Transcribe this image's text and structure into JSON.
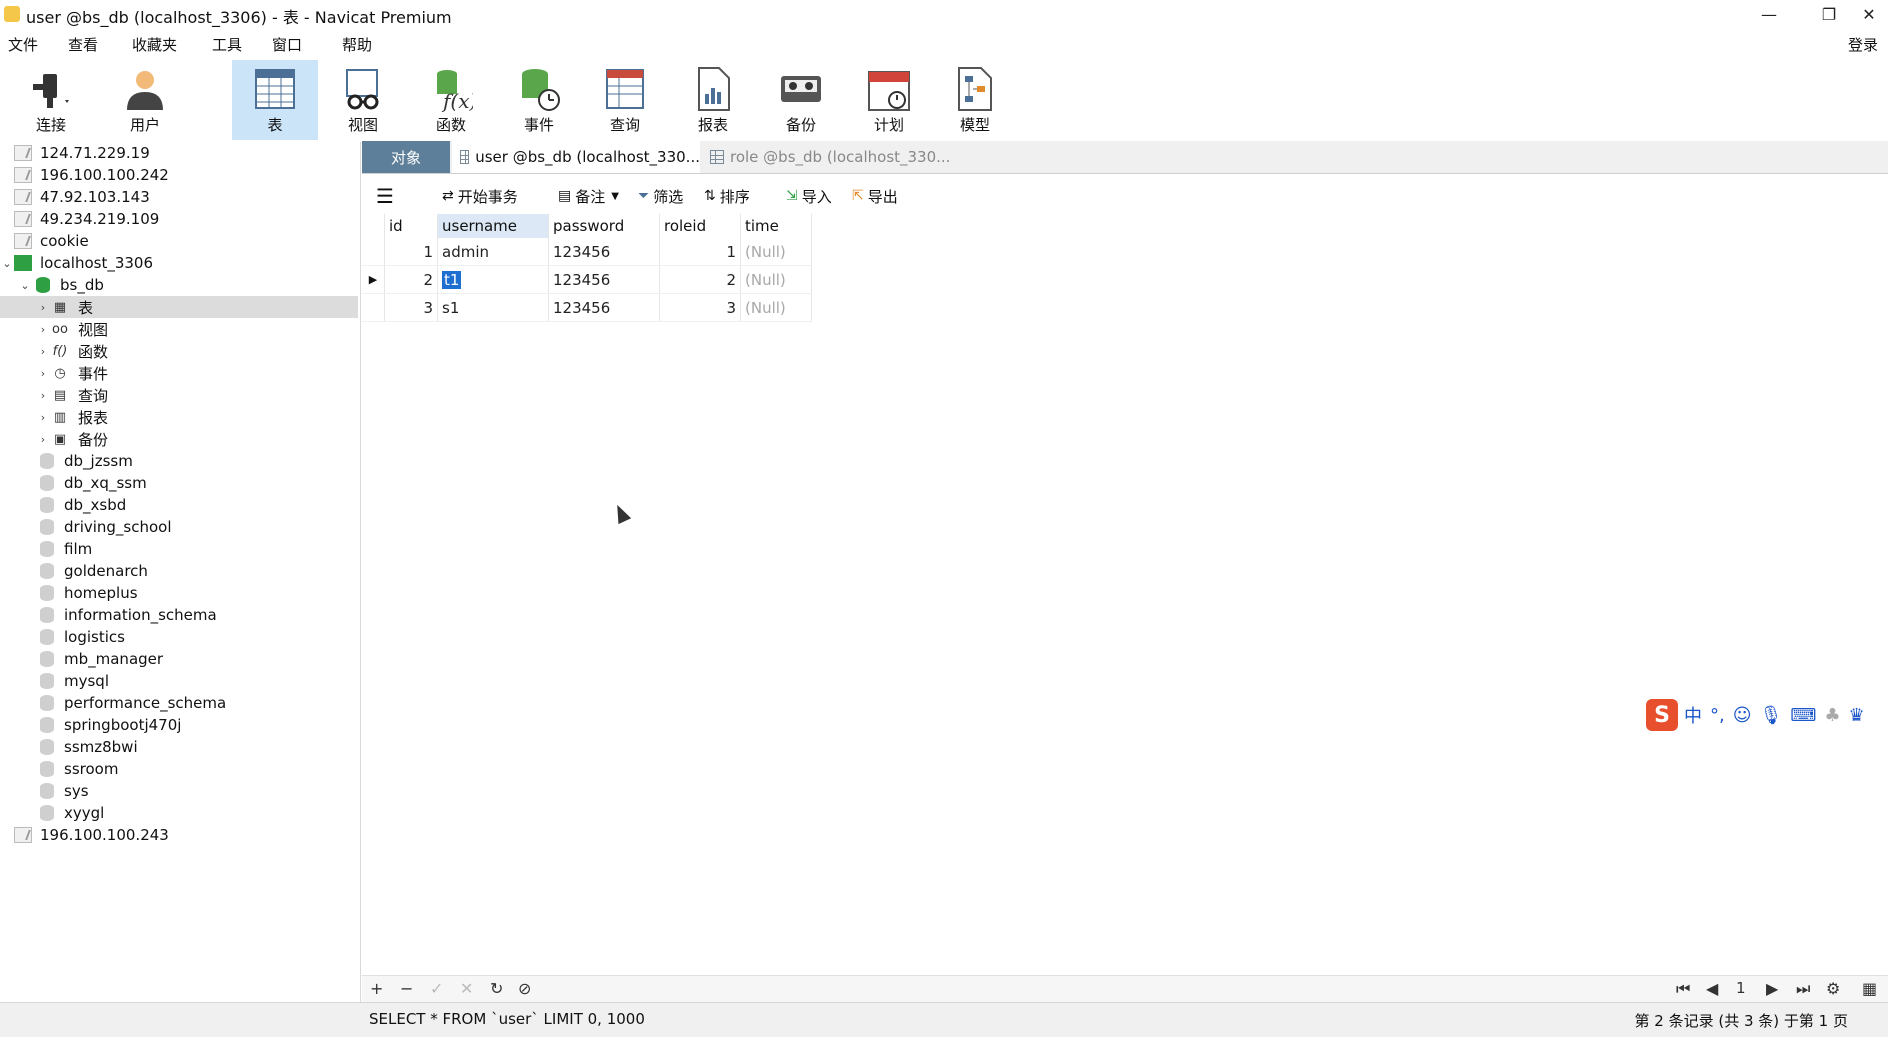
{
  "window": {
    "title": "user @bs_db (localhost_3306) - 表 - Navicat Premium",
    "minimize": "—",
    "restore": "❐",
    "close": "✕"
  },
  "menu": {
    "items": [
      "文件",
      "查看",
      "收藏夹",
      "工具",
      "窗口",
      "帮助"
    ],
    "login": "登录"
  },
  "toolbar": {
    "tools": [
      {
        "label": "连接",
        "icon": "plug-icon"
      },
      {
        "label": "用户",
        "icon": "user-icon"
      },
      {
        "label": "表",
        "icon": "table-icon"
      },
      {
        "label": "视图",
        "icon": "view-glasses-icon"
      },
      {
        "label": "函数",
        "icon": "function-icon"
      },
      {
        "label": "事件",
        "icon": "event-clock-icon"
      },
      {
        "label": "查询",
        "icon": "query-icon"
      },
      {
        "label": "报表",
        "icon": "report-icon"
      },
      {
        "label": "备份",
        "icon": "backup-tape-icon"
      },
      {
        "label": "计划",
        "icon": "calendar-icon"
      },
      {
        "label": "模型",
        "icon": "model-icon"
      }
    ],
    "active": "表"
  },
  "tree": {
    "connections_top": [
      "124.71.229.19",
      "196.100.100.242",
      "47.92.103.143",
      "49.234.219.109",
      "cookie"
    ],
    "active_connection": "localhost_3306",
    "active_db": "bs_db",
    "db_objects": [
      "表",
      "视图",
      "函数",
      "事件",
      "查询",
      "报表",
      "备份"
    ],
    "databases": [
      "db_jzssm",
      "db_xq_ssm",
      "db_xsbd",
      "driving_school",
      "film",
      "goldenarch",
      "homeplus",
      "information_schema",
      "logistics",
      "mb_manager",
      "mysql",
      "performance_schema",
      "springbootj470j",
      "ssmz8bwi",
      "ssroom",
      "sys",
      "xyygl"
    ],
    "connection_bottom": "196.100.100.243"
  },
  "tabs": {
    "object": "对象",
    "user_tab": "user @bs_db (localhost_330...",
    "role_tab": "role @bs_db (localhost_330..."
  },
  "grid_toolbar": {
    "begin_transaction": "开始事务",
    "memo": "备注",
    "filter": "筛选",
    "sort": "排序",
    "import": "导入",
    "export": "导出"
  },
  "table": {
    "columns": [
      "id",
      "username",
      "password",
      "roleid",
      "time"
    ],
    "rows": [
      {
        "id": "1",
        "username": "admin",
        "password": "123456",
        "roleid": "1",
        "time": "(Null)"
      },
      {
        "id": "2",
        "username": "t1",
        "password": "123456",
        "roleid": "2",
        "time": "(Null)"
      },
      {
        "id": "3",
        "username": "s1",
        "password": "123456",
        "roleid": "3",
        "time": "(Null)"
      }
    ],
    "selected_column": "username",
    "current_row": 2
  },
  "bottom_nav": {
    "page": "1"
  },
  "status": {
    "sql": "SELECT * FROM `user` LIMIT 0, 1000",
    "record_info": "第 2 条记录 (共 3 条) 于第 1 页"
  },
  "ime": {
    "logo": "S",
    "mode": "中"
  },
  "colors": {
    "object_tab": "#5d7f99",
    "toolbar_active": "#cce4f7",
    "selection": "#1f6fd1",
    "db_green": "#2ea043"
  }
}
